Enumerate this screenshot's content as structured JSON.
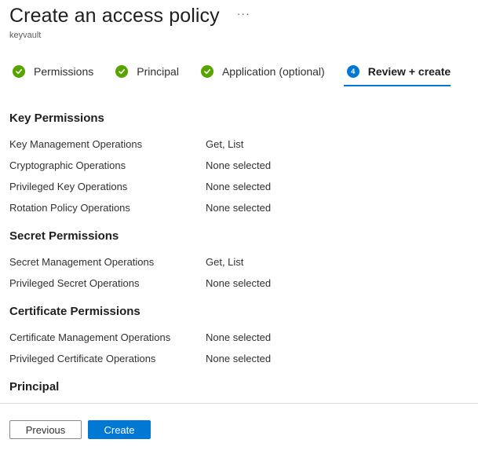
{
  "header": {
    "title": "Create an access policy",
    "more_label": "···",
    "subtitle": "keyvault"
  },
  "steps": [
    {
      "label": "Permissions",
      "state": "complete"
    },
    {
      "label": "Principal",
      "state": "complete"
    },
    {
      "label": "Application (optional)",
      "state": "complete"
    },
    {
      "label": "Review + create",
      "state": "active",
      "number": "4"
    }
  ],
  "sections": {
    "key": {
      "title": "Key Permissions",
      "rows": [
        {
          "label": "Key Management Operations",
          "value": "Get, List"
        },
        {
          "label": "Cryptographic Operations",
          "value": "None selected"
        },
        {
          "label": "Privileged Key Operations",
          "value": "None selected"
        },
        {
          "label": "Rotation Policy Operations",
          "value": "None selected"
        }
      ]
    },
    "secret": {
      "title": "Secret Permissions",
      "rows": [
        {
          "label": "Secret Management Operations",
          "value": "Get, List"
        },
        {
          "label": "Privileged Secret Operations",
          "value": "None selected"
        }
      ]
    },
    "certificate": {
      "title": "Certificate Permissions",
      "rows": [
        {
          "label": "Certificate Management Operations",
          "value": "None selected"
        },
        {
          "label": "Privileged Certificate Operations",
          "value": "None selected"
        }
      ]
    },
    "principal": {
      "title": "Principal"
    }
  },
  "footer": {
    "previous_label": "Previous",
    "create_label": "Create"
  },
  "colors": {
    "accent": "#0078d4",
    "success": "#57a300"
  }
}
